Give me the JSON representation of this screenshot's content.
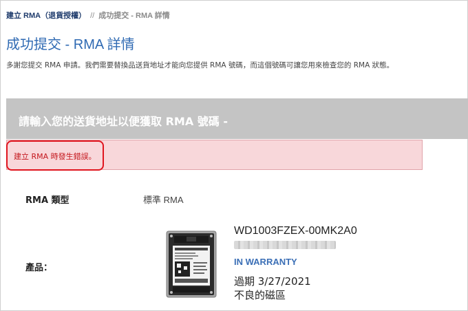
{
  "breadcrumb": {
    "link_label": "建立 RMA（退貨授權）",
    "separator": "//",
    "current": "成功提交 - RMA 詳情"
  },
  "page": {
    "title": "成功提交 - RMA 詳情",
    "intro": "多謝您提交 RMA 申請。我們需要替換品送貨地址才能向您提供 RMA 號碼，而這個號碼可讓您用來檢查您的 RMA 狀態。"
  },
  "address_prompt": "請輸入您的送貨地址以便獲取 RMA 號碼 -",
  "error": {
    "message": "建立 RMA 時發生錯誤。",
    "color": "#c4161c"
  },
  "rma_type": {
    "label": "RMA 類型",
    "value": "標準 RMA"
  },
  "product": {
    "label": "產品：",
    "image_icon": "hard-drive-image",
    "model": "WD1003FZEX-00MK2A0",
    "warranty_status": "IN WARRANTY",
    "warranty_color": "#3b6fb6",
    "expiry": "過期 3/27/2021",
    "issue": "不良的磁區"
  }
}
